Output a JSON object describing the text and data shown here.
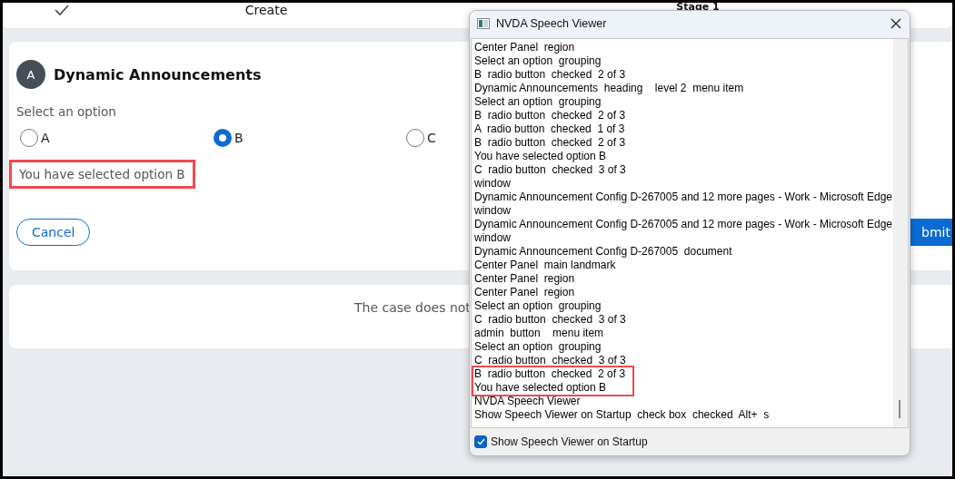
{
  "stages": [
    {
      "done": true
    },
    {
      "label": "Create",
      "done": false
    },
    {
      "label": "Stage 1",
      "done": false
    }
  ],
  "form": {
    "avatar": "A",
    "title": "Dynamic Announcements",
    "group_label": "Select an option",
    "options": [
      {
        "label": "A",
        "selected": false
      },
      {
        "label": "B",
        "selected": true
      },
      {
        "label": "C",
        "selected": false
      }
    ],
    "message": {
      "text": "You have selected option B",
      "highlighted": true
    },
    "cancel": "Cancel",
    "submit": "bmit"
  },
  "notice": "The case does not",
  "speech_viewer": {
    "title": "NVDA Speech Viewer",
    "lines": [
      {
        "text": "Center Panel  region",
        "highlighted": false
      },
      {
        "text": "Select an option  grouping",
        "highlighted": false
      },
      {
        "text": "B  radio button  checked  2 of 3",
        "highlighted": false
      },
      {
        "text": "Dynamic Announcements  heading    level 2  menu item",
        "highlighted": false
      },
      {
        "text": "Select an option  grouping",
        "highlighted": false
      },
      {
        "text": "B  radio button  checked  2 of 3",
        "highlighted": false
      },
      {
        "text": "A  radio button  checked  1 of 3",
        "highlighted": false
      },
      {
        "text": "B  radio button  checked  2 of 3",
        "highlighted": false
      },
      {
        "text": "You have selected option B",
        "highlighted": false
      },
      {
        "text": "C  radio button  checked  3 of 3",
        "highlighted": false
      },
      {
        "text": "window",
        "highlighted": false
      },
      {
        "text": "Dynamic Announcement Config D-267005 and 12 more pages - Work - Microsoft Edge",
        "highlighted": false
      },
      {
        "text": "window",
        "highlighted": false
      },
      {
        "text": "Dynamic Announcement Config D-267005 and 12 more pages - Work - Microsoft Edge",
        "highlighted": false
      },
      {
        "text": "window",
        "highlighted": false
      },
      {
        "text": "Dynamic Announcement Config D-267005  document",
        "highlighted": false
      },
      {
        "text": "Center Panel  main landmark",
        "highlighted": false
      },
      {
        "text": "Center Panel  region",
        "highlighted": false
      },
      {
        "text": "Center Panel  region",
        "highlighted": false
      },
      {
        "text": "Select an option  grouping",
        "highlighted": false
      },
      {
        "text": "C  radio button  checked  3 of 3",
        "highlighted": false
      },
      {
        "text": "admin  button    menu item",
        "highlighted": false
      },
      {
        "text": "Select an option  grouping",
        "highlighted": false
      },
      {
        "text": "C  radio button  checked  3 of 3",
        "highlighted": false
      },
      {
        "text": "B  radio button  checked  2 of 3",
        "highlighted": true
      },
      {
        "text": "You have selected option B",
        "highlighted": true
      },
      {
        "text": "NVDA Speech Viewer",
        "highlighted": false
      },
      {
        "text": "Show Speech Viewer on Startup  check box  checked  Alt+  s",
        "highlighted": false
      }
    ],
    "startup_checkbox": {
      "label": "Show Speech Viewer on Startup",
      "checked": true
    }
  }
}
